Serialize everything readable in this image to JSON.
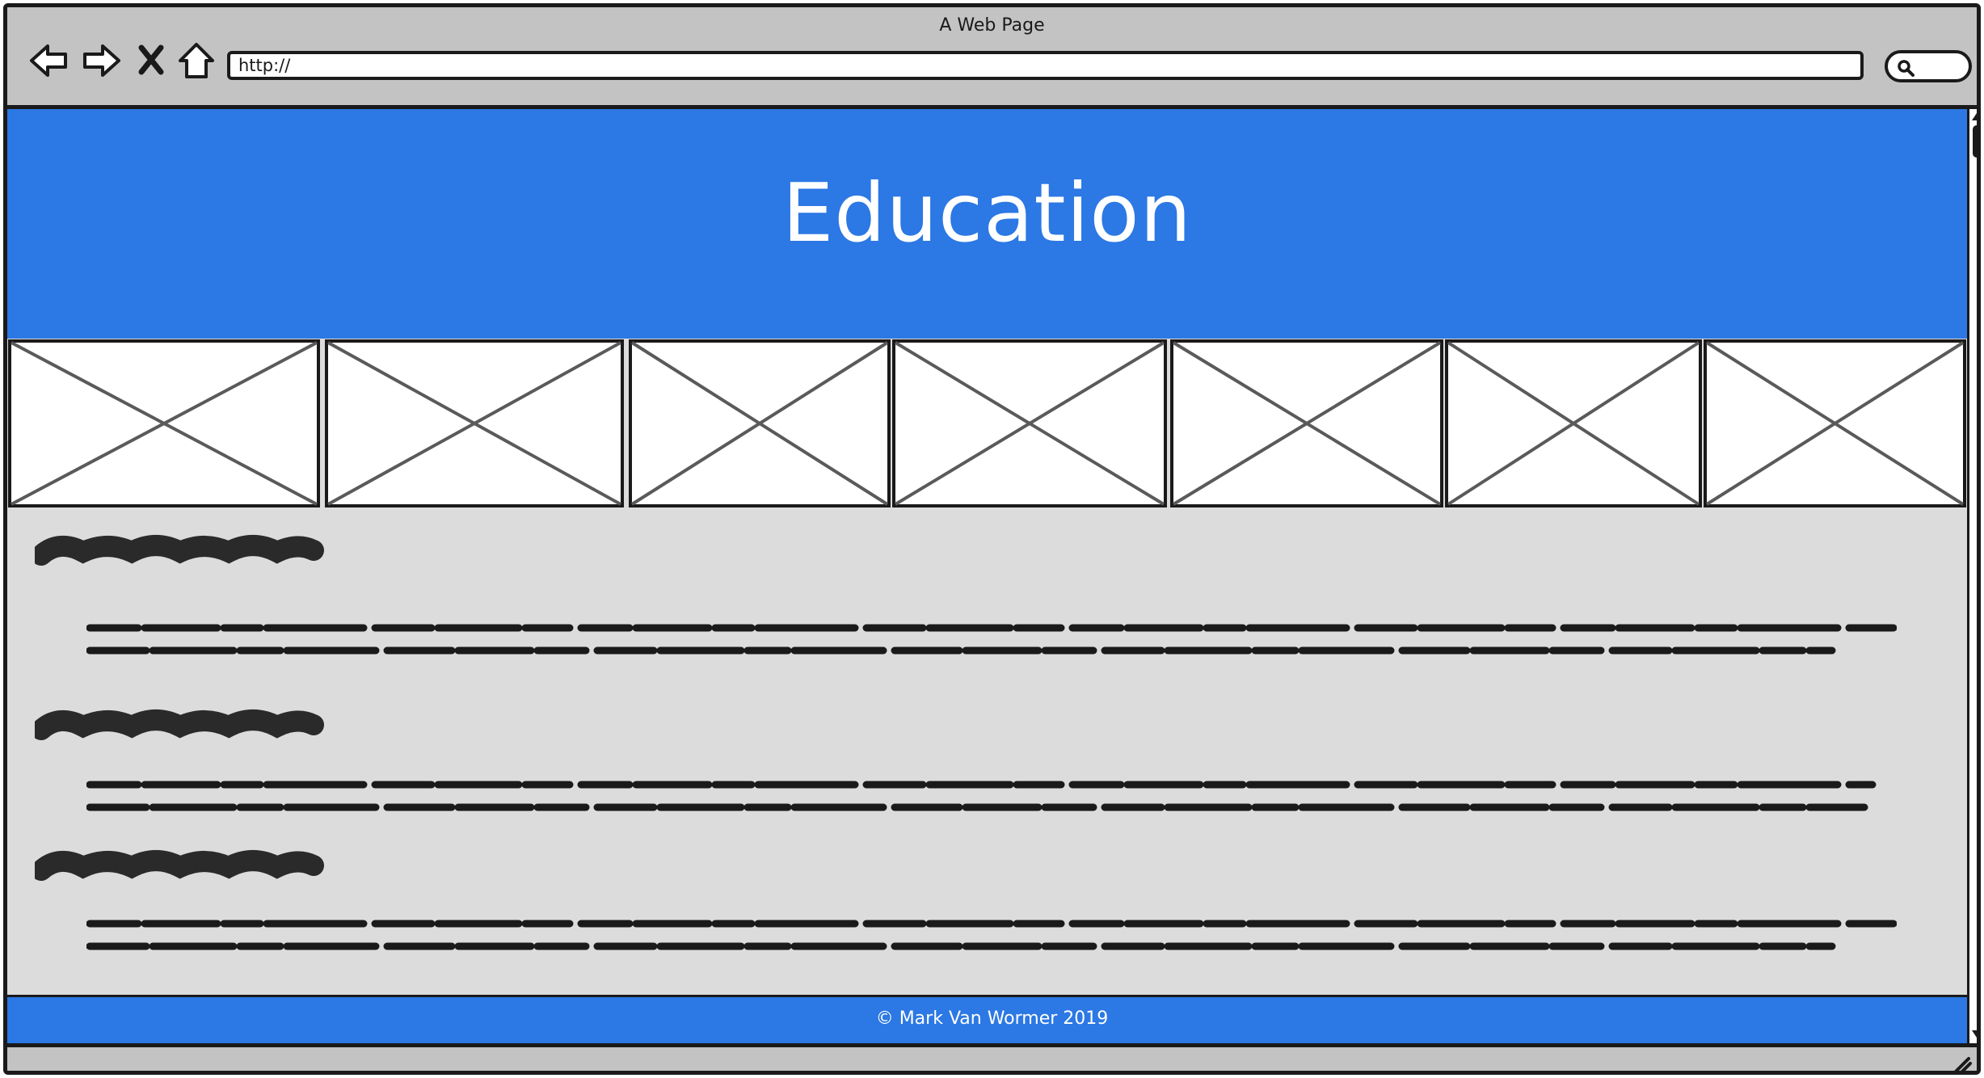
{
  "window": {
    "title": "A Web Page"
  },
  "toolbar": {
    "back_icon": "back-arrow-icon",
    "forward_icon": "forward-arrow-icon",
    "stop_icon": "close-icon",
    "home_icon": "home-icon",
    "url_value": "http://",
    "search_icon": "search-icon"
  },
  "page": {
    "hero_title": "Education",
    "hero_color": "#2c78e4",
    "image_placeholder_count": 7,
    "sections": [
      {
        "heading": "",
        "paragraph_lines": 2
      },
      {
        "heading": "",
        "paragraph_lines": 2
      },
      {
        "heading": "",
        "paragraph_lines": 2
      }
    ],
    "footer_text": "© Mark Van Wormer 2019"
  }
}
